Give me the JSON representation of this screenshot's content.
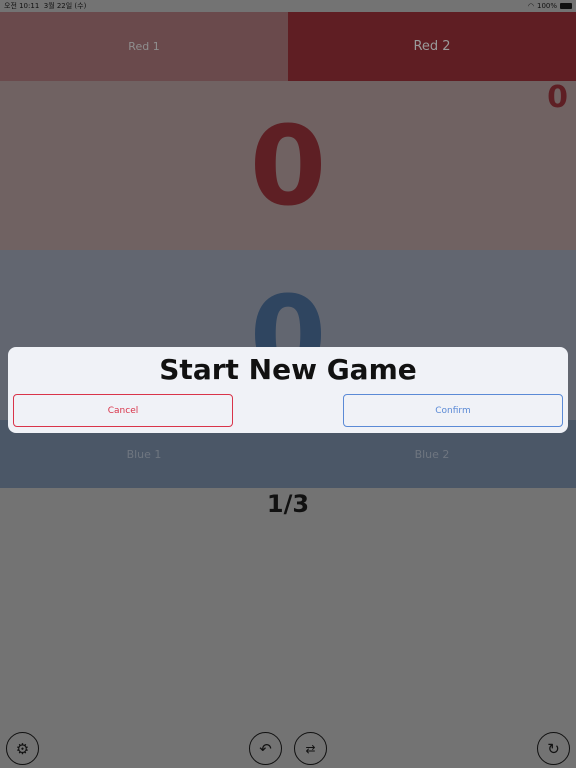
{
  "status_bar": {
    "time": "오전 10:11",
    "date": "3월 22일 (수)",
    "battery": "100%"
  },
  "red": {
    "players": [
      "Red 1",
      "Red 2"
    ],
    "score": "0",
    "sets": "0"
  },
  "blue": {
    "players": [
      "Blue 1",
      "Blue 2"
    ],
    "score": "0"
  },
  "round": "1/3",
  "dialog": {
    "title": "Start New Game",
    "cancel": "Cancel",
    "confirm": "Confirm"
  },
  "toolbar": {
    "icons": [
      "gear-icon",
      "undo-icon",
      "swap-icon",
      "refresh-icon"
    ]
  }
}
